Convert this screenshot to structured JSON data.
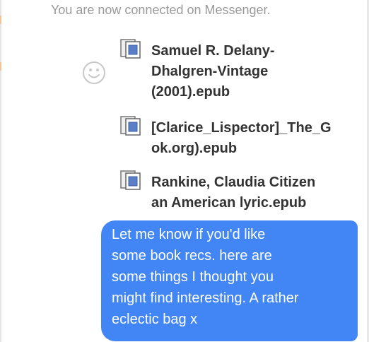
{
  "conversation": {
    "system_message": "You are now connected on Messenger.",
    "attachments": [
      {
        "icon": "document-icon",
        "name": "Samuel R. Delany-\nDhalgren-Vintage\n(2001).epub"
      },
      {
        "icon": "document-icon",
        "name": "[Clarice_Lispector]_The_G\nok.org).epub"
      },
      {
        "icon": "document-icon",
        "name": "Rankine, Claudia Citizen\nan American lyric.epub"
      }
    ],
    "outgoing_message": "Let me know if you'd like\nsome book recs. here are\nsome things I thought you\nmight find interesting. A rather\neclectic bag x"
  },
  "colors": {
    "bubble": "#4285f4",
    "system_text": "#9a9a9a",
    "attachment_text": "#333333"
  }
}
